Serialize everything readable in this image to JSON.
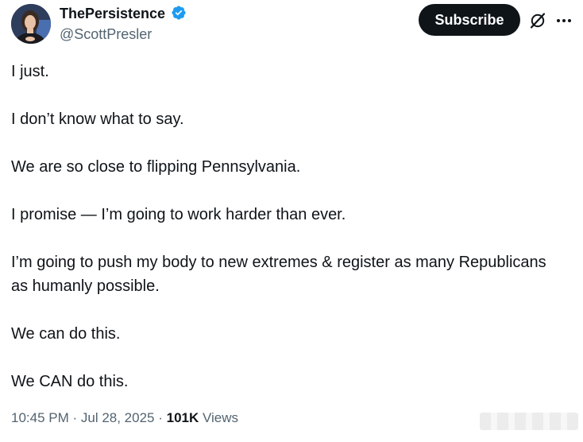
{
  "author": {
    "display_name": "ThePersistence",
    "handle": "@ScottPresler",
    "verified": true,
    "verified_color": "#1d9bf0"
  },
  "header": {
    "subscribe_label": "Subscribe",
    "grok_icon": "grok-icon",
    "more_icon": "more-icon"
  },
  "tweet": {
    "paragraphs": [
      "I just.",
      "I don’t know what to say.",
      "We are so close to flipping Pennsylvania.",
      "I promise — I’m going to work harder than ever.",
      "I’m going to push my body to new extremes & register as many Republicans as humanly possible.",
      "We can do this.",
      "We CAN do this."
    ]
  },
  "meta": {
    "time": "10:45 PM",
    "separator": " · ",
    "date": "Jul 28, 2025",
    "views_count": "101K",
    "views_label": " Views"
  },
  "colors": {
    "text": "#0f1419",
    "secondary": "#536471",
    "button_bg": "#0f1419",
    "button_text": "#ffffff"
  }
}
